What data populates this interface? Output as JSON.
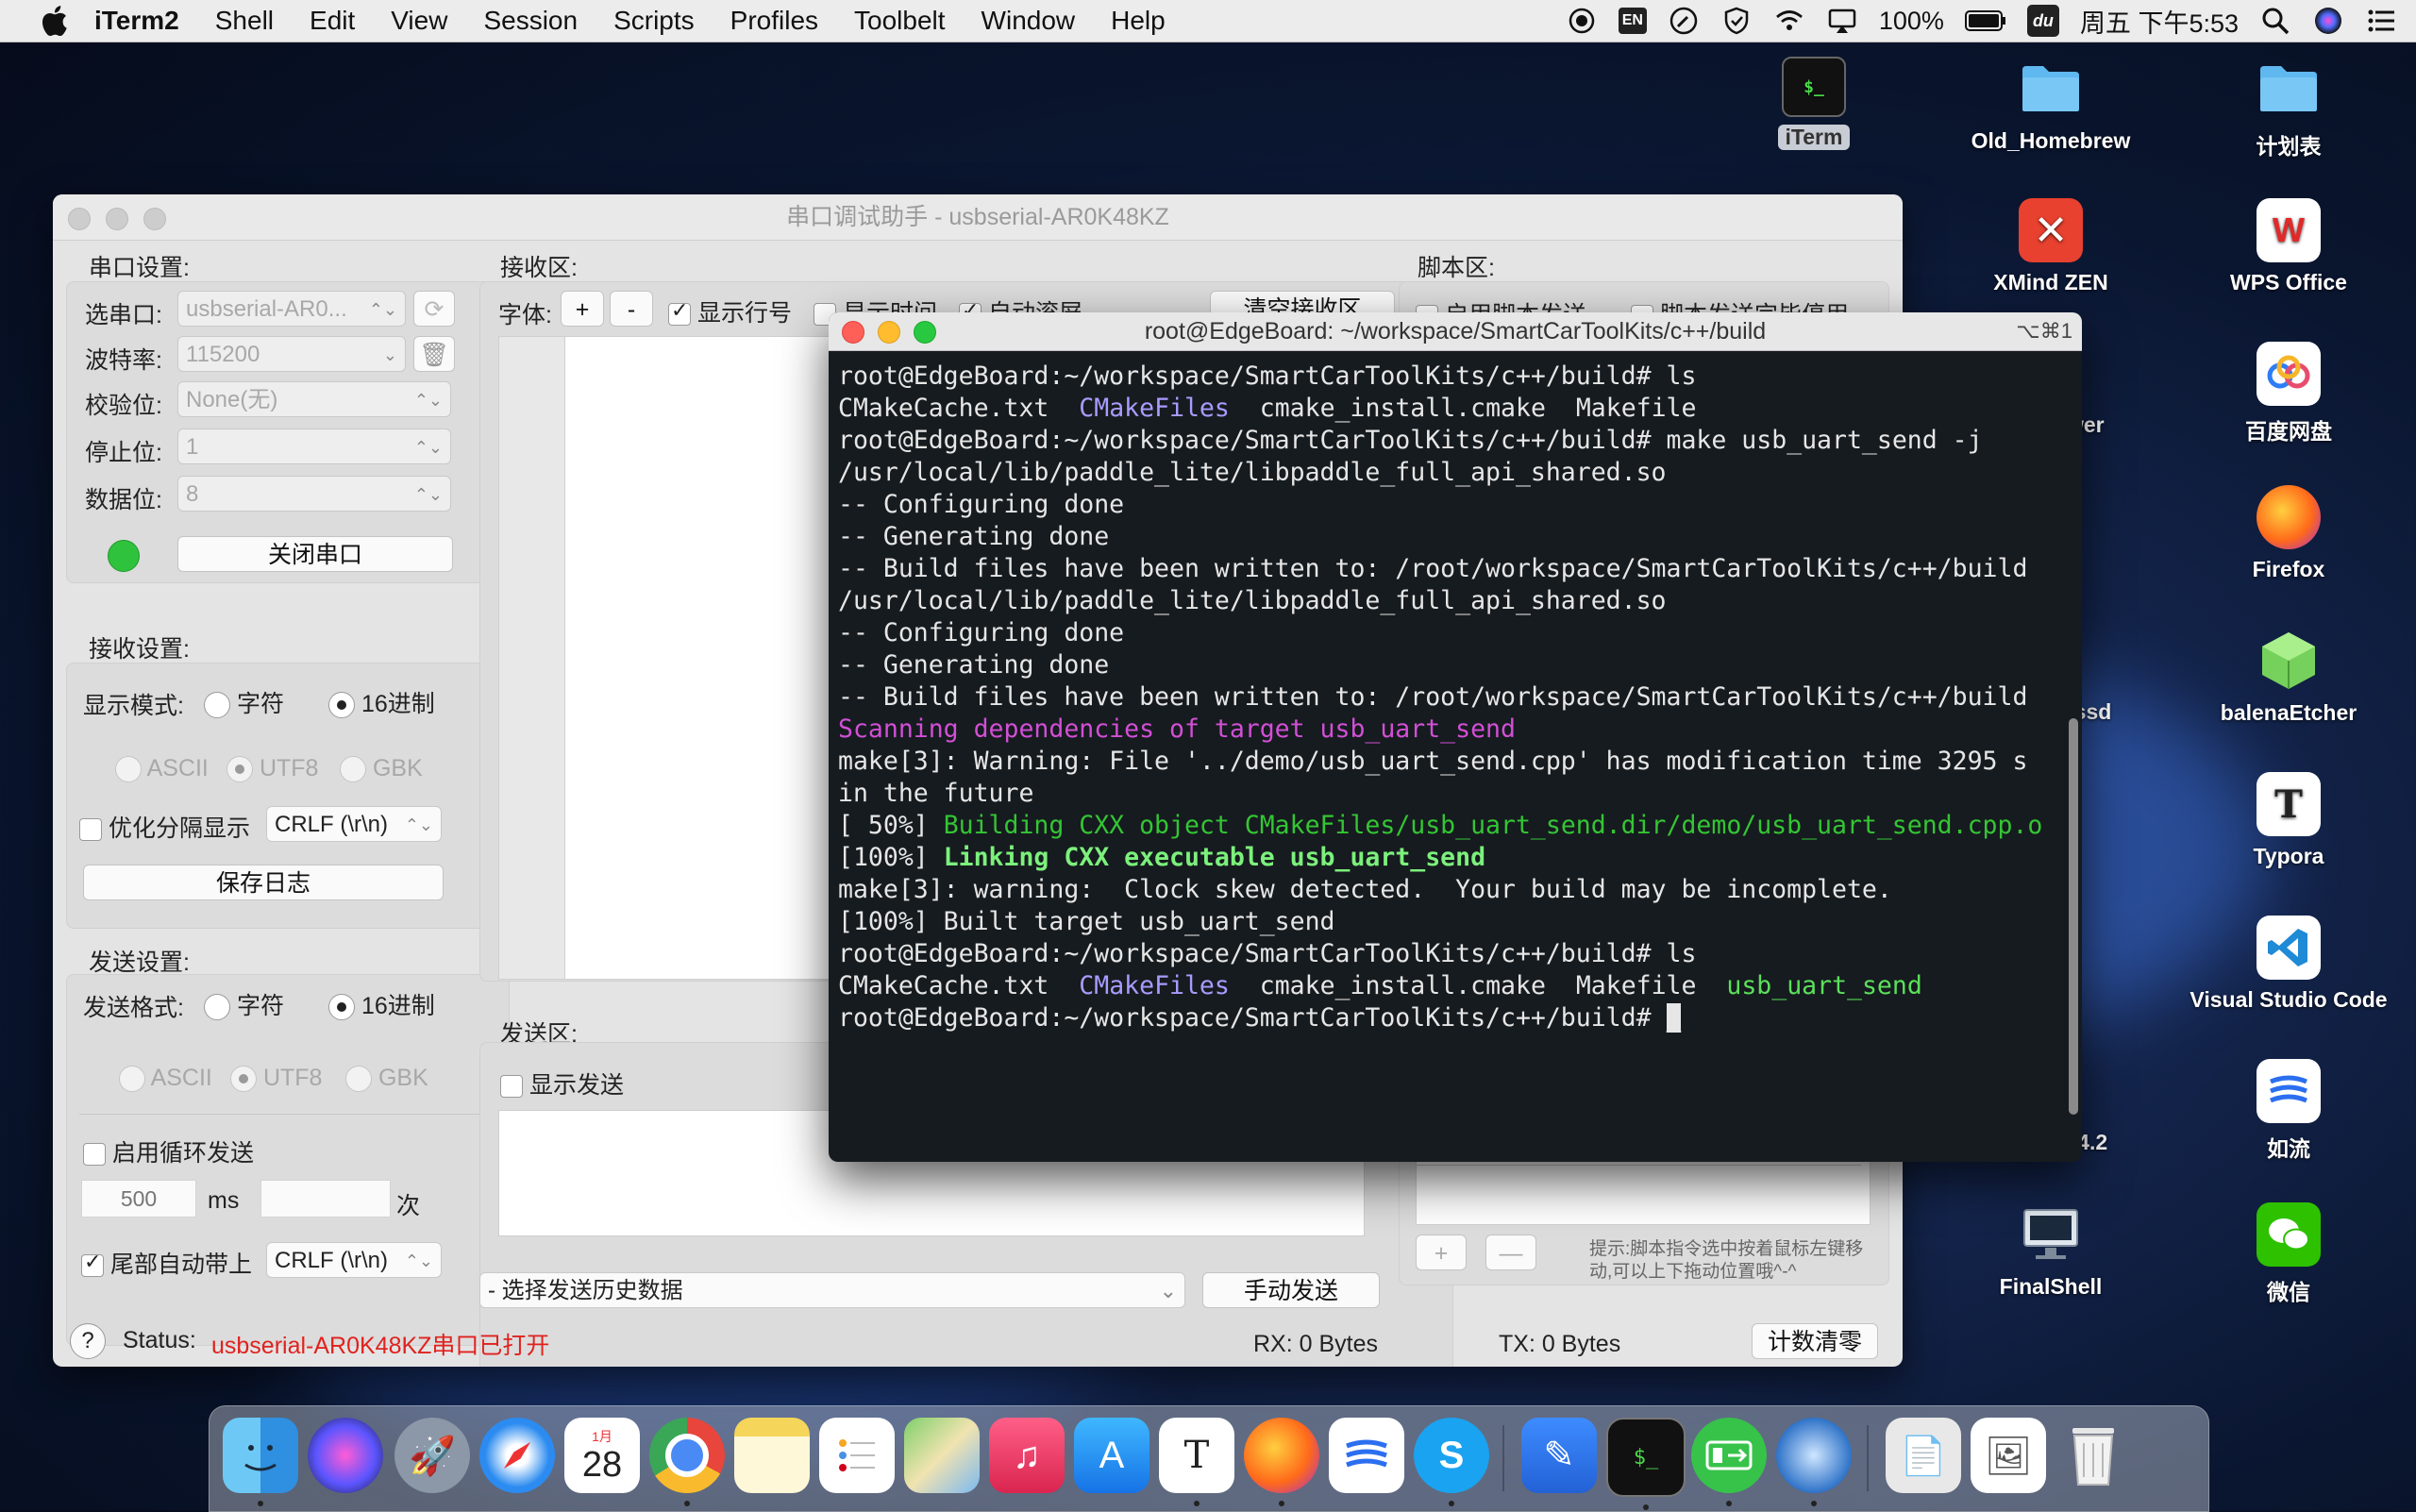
{
  "menubar": {
    "app_name": "iTerm2",
    "items": [
      "Shell",
      "Edit",
      "View",
      "Session",
      "Scripts",
      "Profiles",
      "Toolbelt",
      "Window",
      "Help"
    ],
    "input_method": "EN",
    "battery": "100%",
    "datetime": "周五 下午5:53"
  },
  "desktop_icons": [
    {
      "label": "iTerm",
      "icon": "iterm-icon"
    },
    {
      "label": "Old_Homebrew",
      "icon": "folder-icon"
    },
    {
      "label": "计划表",
      "icon": "folder-icon"
    },
    {
      "label": "XMind ZEN",
      "icon": "xmind-icon"
    },
    {
      "label": "WPS Office",
      "icon": "wps-icon"
    },
    {
      "label": "百度网盘",
      "icon": "baidu-netdisk-icon"
    },
    {
      "label": "Firefox",
      "icon": "firefox-icon"
    },
    {
      "label": "balenaEtcher",
      "icon": "etcher-icon"
    },
    {
      "label": "Typora",
      "icon": "typora-icon"
    },
    {
      "label": "Visual Studio Code",
      "icon": "vscode-icon"
    },
    {
      "label": "如流",
      "icon": "ruliu-icon"
    },
    {
      "label": "FinalShell",
      "icon": "finalshell-icon"
    },
    {
      "label": "微信",
      "icon": "wechat-icon"
    }
  ],
  "partial_labels": [
    "wer",
    "-ssd",
    ".04.2"
  ],
  "serial": {
    "title": "串口调试助手 - usbserial-AR0K48KZ",
    "port_settings": {
      "header": "串口设置:",
      "port_label": "选串口:",
      "port_value": "usbserial-AR0...",
      "baud_label": "波特率:",
      "baud_value": "115200",
      "parity_label": "校验位:",
      "parity_value": "None(无)",
      "stop_label": "停止位:",
      "stop_value": "1",
      "data_label": "数据位:",
      "data_value": "8",
      "close_button": "关闭串口"
    },
    "receive_settings": {
      "header": "接收设置:",
      "mode_label": "显示模式:",
      "opt_char": "字符",
      "opt_hex": "16进制",
      "enc_ascii": "ASCII",
      "enc_utf8": "UTF8",
      "enc_gbk": "GBK",
      "split_label": "优化分隔显示",
      "split_value": "CRLF (\\r\\n)",
      "save_log": "保存日志"
    },
    "send_settings": {
      "header": "发送设置:",
      "format_label": "发送格式:",
      "opt_char": "字符",
      "opt_hex": "16进制",
      "enc_ascii": "ASCII",
      "enc_utf8": "UTF8",
      "enc_gbk": "GBK",
      "loop_label": "启用循环发送",
      "interval_placeholder": "500",
      "ms_unit": "ms",
      "times_unit": "次",
      "tail_label": "尾部自动带上",
      "tail_value": "CRLF (\\r\\n)"
    },
    "receive_area": {
      "header": "接收区:",
      "font_label": "字体:",
      "plus": "+",
      "minus": "-",
      "show_line_no": "显示行号",
      "show_time": "显示时间",
      "auto_scroll": "自动滚屏",
      "clear_button": "清空接收区"
    },
    "send_area": {
      "header": "发送区:",
      "show_send": "显示发送",
      "history_placeholder": "- 选择发送历史数据",
      "send_button": "手动发送"
    },
    "script_area": {
      "header": "脚本区:",
      "enable_script": "启用脚本发送",
      "script_option": "脚本发送完毕停用",
      "add": "+",
      "remove": "—",
      "hint": "提示:脚本指令选中按着鼠标左键移动,可以上下拖动位置哦^-^"
    },
    "status": {
      "help": "?",
      "label": "Status:",
      "message": "usbserial-AR0K48KZ串口已打开",
      "rx": "RX: 0 Bytes",
      "tx": "TX: 0 Bytes",
      "reset_button": "计数清零"
    }
  },
  "terminal": {
    "title": "root@EdgeBoard: ~/workspace/SmartCarToolKits/c++/build",
    "shortcut": "⌥⌘1",
    "prompt": "root@EdgeBoard:~/workspace/SmartCarToolKits/c++/build#",
    "cmd_ls": "ls",
    "cmd_make": "make usb_uart_send -j",
    "f_cmakecache": "CMakeCache.txt",
    "f_cmakefiles": "CMakeFiles",
    "f_cmake_install": "cmake_install.cmake",
    "f_makefile": "Makefile",
    "f_exe": "usb_uart_send",
    "line_lib": "/usr/local/lib/paddle_lite/libpaddle_full_api_shared.so",
    "line_conf": "-- Configuring done",
    "line_gen": "-- Generating done",
    "line_written": "-- Build files have been written to: /root/workspace/SmartCarToolKits/c++/build",
    "line_scan": "Scanning dependencies of target usb_uart_send",
    "line_warn1": "make[3]: Warning: File '../demo/usb_uart_send.cpp' has modification time 3295 s",
    "line_warn2": "in the future",
    "line_build_pct": "[ 50%] ",
    "line_build_txt": "Building CXX object CMakeFiles/usb_uart_send.dir/demo/usb_uart_send.cpp.o",
    "line_link_pct": "[100%] ",
    "line_link_txt": "Linking CXX executable usb_uart_send",
    "line_skew": "make[3]: warning:  Clock skew detected.  Your build may be incomplete.",
    "line_built": "[100%] Built target usb_uart_send"
  },
  "dock": {
    "apps": [
      "finder-icon",
      "siri-icon",
      "launchpad-icon",
      "safari-icon",
      "calendar-icon",
      "chrome-icon",
      "notes-icon",
      "reminders-icon",
      "maps-icon",
      "music-icon",
      "appstore-icon",
      "typora-icon",
      "firefox-icon",
      "ruliu-icon",
      "skype-icon",
      "pencil-icon",
      "iterm-icon",
      "serial-tool-icon",
      "quicktime-icon",
      "document-icon",
      "preview-icon",
      "trash-icon"
    ],
    "calendar_month": "1月",
    "calendar_day": "28"
  }
}
